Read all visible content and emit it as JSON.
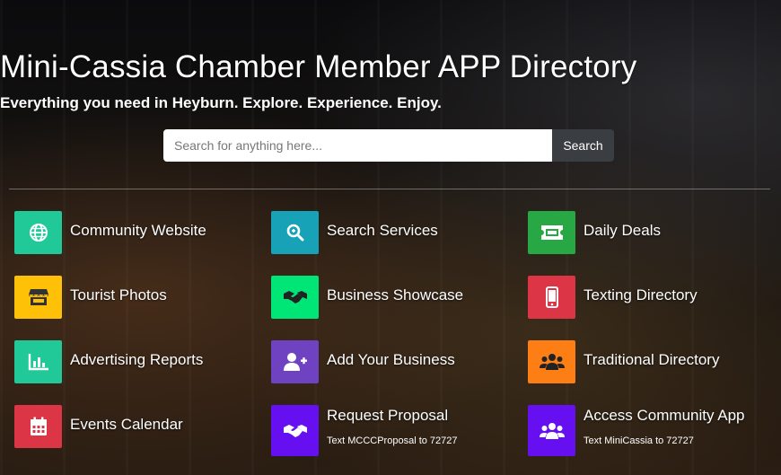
{
  "header": {
    "title": "Mini-Cassia Chamber Member APP Directory",
    "subtitle": "Everything you need in Heyburn. Explore. Experience. Enjoy."
  },
  "search": {
    "placeholder": "Search for anything here...",
    "button_label": "Search"
  },
  "tiles": [
    {
      "label": "Community Website",
      "color": "#20c997",
      "icon": "globe-icon"
    },
    {
      "label": "Search Services",
      "color": "#17a2b8",
      "icon": "search-icon"
    },
    {
      "label": "Daily Deals",
      "color": "#28a745",
      "icon": "ticket-icon"
    },
    {
      "label": "Tourist Photos",
      "color": "#ffc107",
      "icon": "store-icon"
    },
    {
      "label": "Business Showcase",
      "color": "#00e676",
      "icon": "handshake-icon"
    },
    {
      "label": "Texting Directory",
      "color": "#dc3545",
      "icon": "mobile-icon"
    },
    {
      "label": "Advertising Reports",
      "color": "#20c997",
      "icon": "chart-icon"
    },
    {
      "label": "Add Your Business",
      "color": "#6f42c1",
      "icon": "user-plus-icon"
    },
    {
      "label": "Traditional Directory",
      "color": "#fd7e14",
      "icon": "users-icon"
    },
    {
      "label": "Events Calendar",
      "color": "#dc3545",
      "icon": "calendar-icon"
    },
    {
      "label": "Request Proposal",
      "color": "#6610f2",
      "icon": "handshake-icon",
      "sub": "Text MCCCProposal to 72727"
    },
    {
      "label": "Access Community App",
      "color": "#6610f2",
      "icon": "users-icon",
      "sub": "Text MiniCassia to 72727"
    }
  ]
}
